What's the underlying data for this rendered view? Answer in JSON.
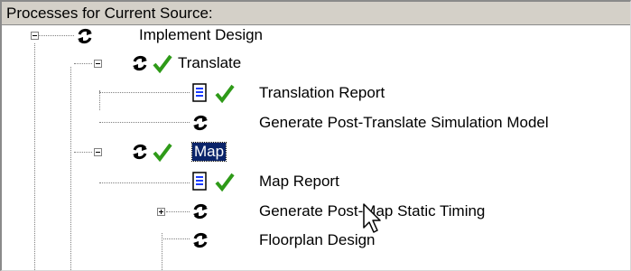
{
  "panel": {
    "title": "Processes for Current Source:"
  },
  "tree": {
    "implement_design": "Implement Design",
    "translate": "Translate",
    "translation_report": "Translation Report",
    "generate_post_translate": "Generate Post-Translate Simulation Model",
    "map": "Map",
    "map_report": "Map Report",
    "generate_post_map": "Generate Post-Map Static Timing",
    "floorplan_design": "Floorplan Design"
  },
  "colors": {
    "selection": "#0a246a",
    "checkmark": "#2e9a18",
    "header_bg": "#d4d0c8"
  },
  "icons": [
    "refresh-icon",
    "check-icon",
    "report-document-icon",
    "tree-expander-icon",
    "mouse-pointer-icon"
  ]
}
